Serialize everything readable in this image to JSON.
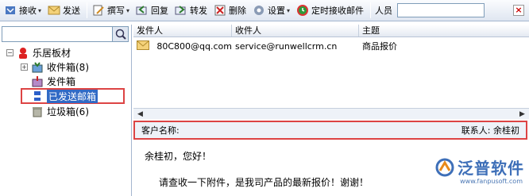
{
  "toolbar": {
    "receive": "接收",
    "send": "发送",
    "compose": "撰写",
    "reply": "回复",
    "forward": "转发",
    "delete": "删除",
    "settings": "设置",
    "scheduled": "定时接收邮件",
    "person_label": "人员",
    "person_value": ""
  },
  "tree": {
    "root": "乐居板材",
    "inbox": "收件箱(8)",
    "outbox": "发件箱",
    "sent": "已发送邮箱",
    "trash": "垃圾箱(6)"
  },
  "list": {
    "headers": [
      "发件人",
      "收件人",
      "主题"
    ],
    "rows": [
      {
        "from": "80C800@qq.com",
        "to": "service@runwellcrm.cn",
        "subject": "商品报价"
      }
    ]
  },
  "detail": {
    "customer_label": "客户名称:",
    "contact_label": "联系人: 余桂初"
  },
  "body": {
    "greeting": "余桂初，您好！",
    "text": "请查收一下附件，是我司产品的最新报价！谢谢！"
  },
  "watermark": {
    "name": "泛普软件",
    "url": "www.fanpusoft.com"
  },
  "colors": {
    "highlight_border": "#d44444",
    "selection": "#316ac5",
    "brand": "#3e6fb8"
  }
}
